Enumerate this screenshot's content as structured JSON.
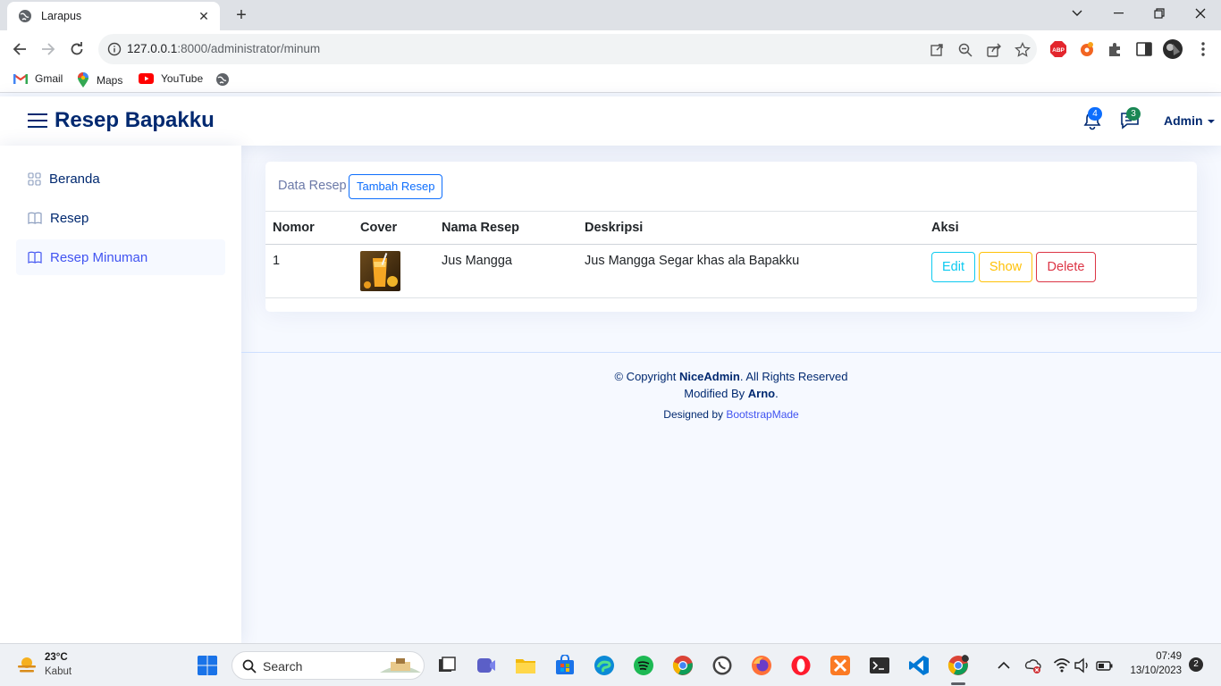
{
  "browser": {
    "tab_title": "Larapus",
    "url_host": "127.0.0.1",
    "url_rest": ":8000/administrator/minum",
    "bookmarks": [
      "Gmail",
      "Maps",
      "YouTube"
    ]
  },
  "header": {
    "brand": "Resep Bapakku",
    "notification_count": "4",
    "message_count": "3",
    "user_label": "Admin"
  },
  "sidebar": {
    "items": [
      {
        "label": "Beranda",
        "icon": "grid-icon"
      },
      {
        "label": "Resep",
        "icon": "book-icon"
      },
      {
        "label": "Resep Minuman",
        "icon": "book-icon",
        "active": true
      }
    ]
  },
  "card": {
    "tab_label": "Data Resep",
    "add_button": "Tambah Resep",
    "columns": [
      "Nomor",
      "Cover",
      "Nama Resep",
      "Deskripsi",
      "Aksi"
    ],
    "rows": [
      {
        "nomor": "1",
        "nama": "Jus Mangga",
        "deskripsi": "Jus Mangga Segar khas ala Bapakku",
        "actions": [
          "Edit",
          "Show",
          "Delete"
        ]
      }
    ]
  },
  "footer": {
    "copyright_prefix": "© Copyright ",
    "copyright_brand": "NiceAdmin",
    "copyright_suffix": ". All Rights Reserved",
    "modified_prefix": "Modified By ",
    "modified_name": "Arno",
    "modified_suffix": ".",
    "designed_prefix": "Designed by ",
    "designed_link": "BootstrapMade"
  },
  "taskbar": {
    "weather_temp": "23°C",
    "weather_desc": "Kabut",
    "search_label": "Search",
    "time": "07:49",
    "date": "13/10/2023",
    "notification_count": "2"
  },
  "colors": {
    "brand": "#012970",
    "accent": "#4154f1",
    "primary": "#0d6efd",
    "info": "#0dcaf0",
    "warning": "#ffc107",
    "danger": "#dc3545"
  }
}
